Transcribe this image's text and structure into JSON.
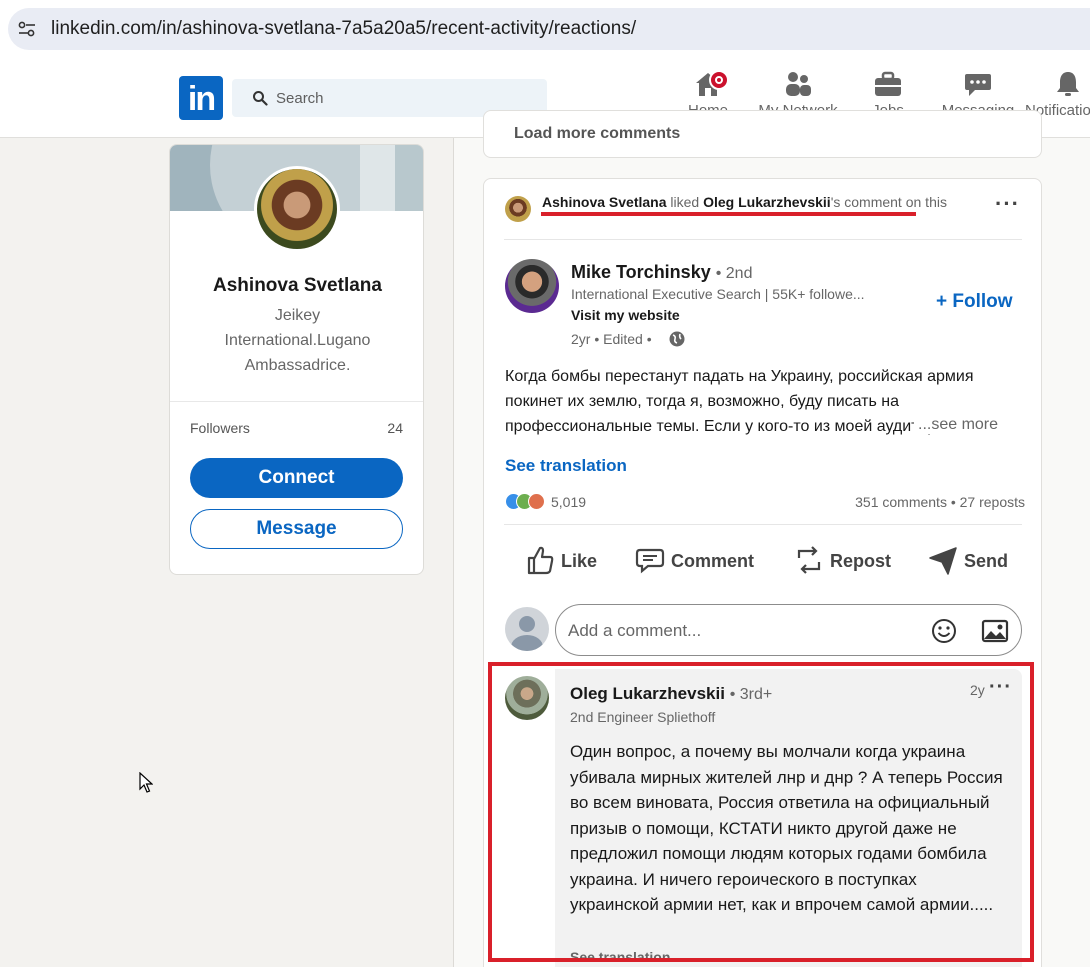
{
  "browser": {
    "url": "linkedin.com/in/ashinova-svetlana-7a5a20a5/recent-activity/reactions/"
  },
  "nav": {
    "logo": "in",
    "search_placeholder": "Search",
    "items": [
      {
        "label": "Home",
        "icon": "home-icon"
      },
      {
        "label": "My Network",
        "icon": "network-icon"
      },
      {
        "label": "Jobs",
        "icon": "briefcase-icon"
      },
      {
        "label": "Messaging",
        "icon": "messaging-icon"
      },
      {
        "label": "Notifications",
        "icon": "bell-icon"
      }
    ],
    "accent": "#0a66c2"
  },
  "profile": {
    "name": "Ashinova Svetlana",
    "headline": "Jeikey International.Lugano Ambassadrice.",
    "followers_label": "Followers",
    "followers_count": "24",
    "connect_label": "Connect",
    "message_label": "Message"
  },
  "feed": {
    "load_more": "Load more comments",
    "activity": {
      "actor": "Ashinova Svetlana",
      "verb": "liked",
      "target": "Oleg Lukarzhevskii",
      "suffix": "'s comment on this"
    },
    "post": {
      "author": "Mike Torchinsky",
      "degree": "• 2nd",
      "headline": "International Executive Search | 55K+ followe...",
      "link": "Visit my website",
      "time": "2yr • Edited •",
      "follow_label": "+ Follow",
      "text": "Когда бомбы перестанут падать на Украину, российская армия покинет их землю, тогда я, возможно, буду писать на профессиональные темы. Если у кого-то из моей аудитории",
      "see_more": "...see more",
      "see_translation": "See translation",
      "reactions_count": "5,019",
      "comments_reposts": "351 comments • 27 reposts",
      "actions": [
        "Like",
        "Comment",
        "Repost",
        "Send"
      ],
      "comment_placeholder": "Add a comment..."
    },
    "comment": {
      "author": "Oleg Lukarzhevskii",
      "degree": "• 3rd+",
      "headline": "2nd Engineer Spliethoff",
      "time": "2y",
      "text": "Один вопрос, а почему вы молчали когда украина убивала мирных жителей лнр и днр ? А теперь Россия во всем виновата, Россия ответила на официальный призыв о помощи, КСТАТИ никто другой даже не предложил помощи людям которых годами бомбила украина. И ничего героического в поступках украинской армии нет, как и впрочем самой армии.....",
      "see_translation": "See translation"
    }
  },
  "colors": {
    "annotation_red": "#d9202a",
    "notification_badge": "#cb112d"
  }
}
